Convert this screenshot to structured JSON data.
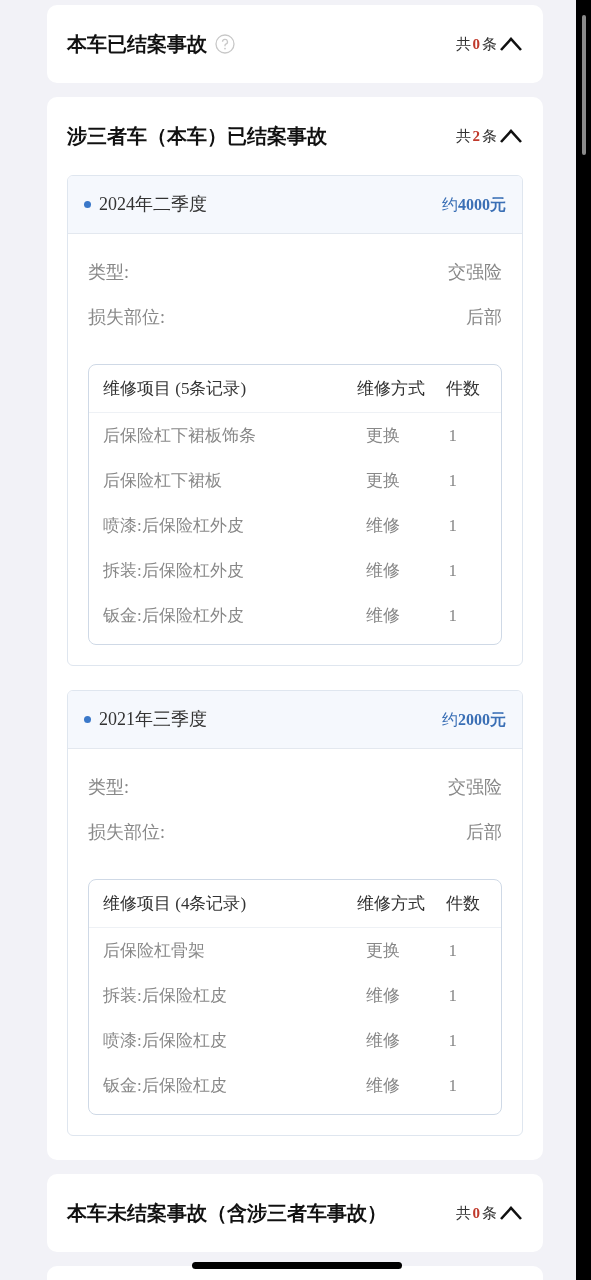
{
  "sections": [
    {
      "title": "本车已结案事故",
      "help": true,
      "total": {
        "prefix": "共",
        "count": "0",
        "suffix": "条"
      },
      "expanded": true
    },
    {
      "title": "涉三者车（本车）已结案事故",
      "help": false,
      "total": {
        "prefix": "共",
        "count": "2",
        "suffix": "条"
      },
      "expanded": true,
      "records": [
        {
          "period": "2024年二季度",
          "amount": "约**4000元**",
          "fields": [
            {
              "label": "类型:",
              "value": "交强险"
            },
            {
              "label": "损失部位:",
              "value": "后部"
            }
          ],
          "table": {
            "columns": [
              "维修项目 (5条记录)",
              "维修方式",
              "件数"
            ],
            "rows": [
              [
                "后保险杠下裙板饰条",
                "更换",
                "1"
              ],
              [
                "后保险杠下裙板",
                "更换",
                "1"
              ],
              [
                "喷漆:后保险杠外皮",
                "维修",
                "1"
              ],
              [
                "拆装:后保险杠外皮",
                "维修",
                "1"
              ],
              [
                "钣金:后保险杠外皮",
                "维修",
                "1"
              ]
            ]
          }
        },
        {
          "period": "2021年三季度",
          "amount": "约**2000元**",
          "fields": [
            {
              "label": "类型:",
              "value": "交强险"
            },
            {
              "label": "损失部位:",
              "value": "后部"
            }
          ],
          "table": {
            "columns": [
              "维修项目 (4条记录)",
              "维修方式",
              "件数"
            ],
            "rows": [
              [
                "后保险杠骨架",
                "更换",
                "1"
              ],
              [
                "拆装:后保险杠皮",
                "维修",
                "1"
              ],
              [
                "喷漆:后保险杠皮",
                "维修",
                "1"
              ],
              [
                "钣金:后保险杠皮",
                "维修",
                "1"
              ]
            ]
          }
        }
      ]
    },
    {
      "title": "本车未结案事故（含涉三者车事故）",
      "help": false,
      "total": {
        "prefix": "共",
        "count": "0",
        "suffix": "条"
      },
      "expanded": true
    }
  ]
}
